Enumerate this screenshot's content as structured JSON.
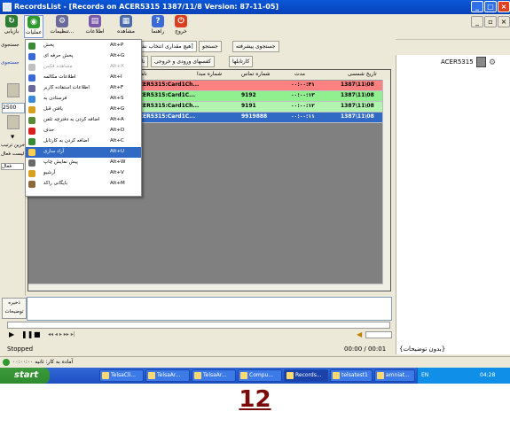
{
  "window": {
    "title": "RecordsList - [Records on ACER5315  1387/11/8 Version: 87-11-05]",
    "controls": {
      "minimize": "_",
      "maximize": "□",
      "close": "×",
      "inner_minimize": "_",
      "inner_restore": "▫",
      "inner_close": "×"
    }
  },
  "toolbar": {
    "items": [
      {
        "label": "بازیابی",
        "icon": "refresh-icon",
        "color": "#2e7d32"
      },
      {
        "label": "عملیات",
        "icon": "operations-icon",
        "color": "#2e9a2e"
      },
      {
        "label": "تنظیمات...",
        "icon": "settings-icon",
        "color": "#6a6a9a"
      },
      {
        "label": "اطلاعات",
        "icon": "info-icon",
        "color": "#7a5aa8"
      },
      {
        "label": "مشاهده",
        "icon": "view-icon",
        "color": "#4a6aa8"
      },
      {
        "label": "راهنما",
        "icon": "help-icon",
        "color": "#3a6ad8"
      },
      {
        "label": "خروج",
        "icon": "exit-icon",
        "color": "#d84020"
      }
    ]
  },
  "left_panel": {
    "search_label": "جستجوی",
    "search_sub": "جستجوی",
    "count_value": "2500",
    "filter_label": "آخرین ترتیب",
    "active_list_label": "لیست فعال",
    "active_label": "فعال"
  },
  "subbar": {
    "advanced_search": "جستجوی پیشرفته",
    "search": "جستجو",
    "unrestricted": "[هیچ مقداری انتخاب نشده]"
  },
  "tabs": [
    "کارتابلها",
    "کفسهای ورودی و خروجی",
    "ناخ"
  ],
  "grid": {
    "columns": [
      "تاریخ شمسی",
      "مدت",
      "شماره تماس",
      "شماره مبدا",
      "نام کا"
    ],
    "rows": [
      {
        "date": "1387\\11\\08",
        "duration": "۰۰:۰۰:۴۱",
        "phone": "",
        "origin": "",
        "line": "ACER5315:Card1Ch...",
        "color": "#ff8080"
      },
      {
        "date": "1387\\11\\08",
        "duration": "۰۰:۰۰:۱۳",
        "phone": "9192",
        "origin": "",
        "line": "ACER5315:Card1C...",
        "color": "#90f090"
      },
      {
        "date": "1387\\11\\08",
        "duration": "۰۰:۰۰:۱۲",
        "phone": "9191",
        "origin": "",
        "line": "ACER5315:Card1Ch...",
        "color": "#b0f4b0"
      },
      {
        "date": "1387\\11\\08",
        "duration": "۰۰:۰۰:۱۱",
        "phone": "9919888",
        "origin": "",
        "line": "ACER5315:Card1C...",
        "color": "#316ac5"
      }
    ]
  },
  "menu": {
    "items": [
      {
        "label": "پخش",
        "shortcut": "Alt+P",
        "state": "normal",
        "icon_color": "#3a8a3a"
      },
      {
        "label": "پخش حرفه ای",
        "shortcut": "Alt+G",
        "state": "normal",
        "icon_color": "#3a6ad8"
      },
      {
        "label": "مشاهده فکس",
        "shortcut": "Alt+X",
        "state": "disabled",
        "icon_color": "#c0c0c0"
      },
      {
        "label": "اطلاعات مکالمه",
        "shortcut": "Alt+I",
        "state": "normal",
        "icon_color": "#3a6ad8"
      },
      {
        "label": "اطلاعات استفاده کاربر",
        "shortcut": "Alt+F",
        "state": "normal",
        "icon_color": "#6a6a9a"
      },
      {
        "label": "فرستادن به",
        "shortcut": "Alt+S",
        "state": "normal",
        "icon_color": "#3a8ad8"
      },
      {
        "label": "یافتن قبل",
        "shortcut": "Alt+G",
        "state": "normal",
        "icon_color": "#d8a020"
      },
      {
        "label": "اضافه کردن به دفترچه تلفن",
        "shortcut": "Alt+A",
        "state": "normal",
        "icon_color": "#5a8a3a"
      },
      {
        "label": "حذف",
        "shortcut": "Alt+D",
        "state": "normal",
        "icon_color": "#d82020"
      },
      {
        "label": "اضافه کردن به کارتابل",
        "shortcut": "Alt+C",
        "state": "normal",
        "icon_color": "#3a8a3a"
      },
      {
        "label": "آزاد سازی",
        "shortcut": "Alt+U",
        "state": "highlighted",
        "icon_color": "#ffd050"
      },
      {
        "label": "پیش نمایش چاپ",
        "shortcut": "Alt+W",
        "state": "normal",
        "icon_color": "#6a6a6a"
      },
      {
        "label": "آرشیو",
        "shortcut": "Alt+V",
        "state": "normal",
        "icon_color": "#d8a020"
      },
      {
        "label": "بایگانی راکد",
        "shortcut": "Alt+M",
        "state": "normal",
        "icon_color": "#8a6a3a"
      }
    ]
  },
  "right_panel": {
    "computer": "ACER5315"
  },
  "notes": {
    "save_label": "ذخیره توضیحات",
    "no_desc": "{بدون توضیحات}"
  },
  "player": {
    "status": "Stopped",
    "time": "00:00 / 00:01"
  },
  "status_bar": {
    "text": "آماده به کار: ثانیه  ۰۰:۰۰:۰۰"
  },
  "taskbar": {
    "start": "start",
    "tasks": [
      "TelsaCli...",
      "TelsaAr...",
      "TelsaAr...",
      "Compu...",
      "Records...",
      "telsatest1",
      "amniat..."
    ],
    "lang": "EN",
    "clock": "04:28"
  },
  "page_number": "12"
}
